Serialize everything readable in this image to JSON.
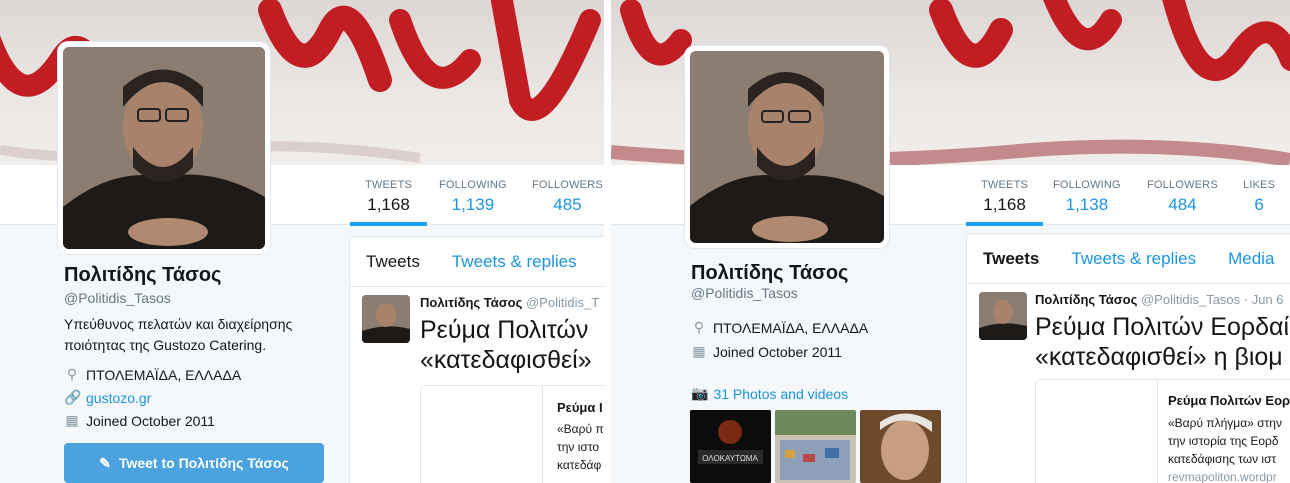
{
  "left": {
    "stats": [
      {
        "label": "TWEETS",
        "value": "1,168"
      },
      {
        "label": "FOLLOWING",
        "value": "1,139"
      },
      {
        "label": "FOLLOWERS",
        "value": "485"
      }
    ],
    "profile": {
      "name": "Πολιτίδης Τάσος",
      "handle": "@Politidis_Tasos",
      "bio_line1": "Υπεύθυνος πελατών και διαχείρησης",
      "bio_line2": "ποιότητας της Gustozo Catering.",
      "location": "ΠΤΟΛΕΜΑΪΔΑ, ΕΛΛΑΔΑ",
      "website": "gustozo.gr",
      "joined": "Joined October 2011"
    },
    "tweet_button": "Tweet to Πολιτίδης Τάσος",
    "tabs": [
      "Tweets",
      "Tweets & replies"
    ],
    "tweet": {
      "author": "Πολιτίδης Τάσος",
      "handle": "@Politidis_T",
      "line1": "Ρεύμα Πολιτών",
      "line2": "«κατεδαφισθεί»",
      "card_title": "Ρεύμα Ι",
      "card_desc1": "«Βαρύ π",
      "card_desc2": "την ιστο",
      "card_desc3": "κατεδάφ"
    }
  },
  "right": {
    "stats": [
      {
        "label": "TWEETS",
        "value": "1,168"
      },
      {
        "label": "FOLLOWING",
        "value": "1,138"
      },
      {
        "label": "FOLLOWERS",
        "value": "484"
      },
      {
        "label": "LIKES",
        "value": "6"
      }
    ],
    "profile": {
      "name": "Πολιτίδης Τάσος",
      "handle": "@Politidis_Tasos",
      "location": "ΠΤΟΛΕΜΑΪΔΑ, ΕΛΛΑΔΑ",
      "joined": "Joined October 2011"
    },
    "photos_label": "31 Photos and videos",
    "thumb1_text": "ΟΛΟΚΑΥΤΩΜΑ",
    "tabs": [
      "Tweets",
      "Tweets & replies",
      "Media"
    ],
    "tweet": {
      "author": "Πολιτίδης Τάσος",
      "meta": "@Politidis_Tasos · Jun 6",
      "line1": "Ρεύμα Πολιτών Εορδαί",
      "line2": "«κατεδαφισθεί» η βιομ",
      "card_title": "Ρεύμα Πολιτών Εορ",
      "card_desc1": "«Βαρύ πλήγμα» στην",
      "card_desc2": "την ιστορία της Εορδ",
      "card_desc3": "κατεδάφισης των ιστ",
      "card_url": "revmapoliton.wordpr"
    }
  }
}
